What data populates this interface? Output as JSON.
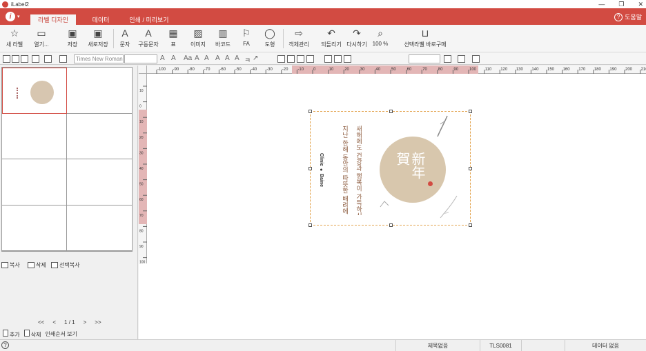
{
  "window": {
    "title": "iLabel2",
    "controls": [
      "—",
      "❐",
      "✕"
    ]
  },
  "ribbon": {
    "file_arrow": "▾",
    "tabs": [
      {
        "label": "라벨 디자인",
        "active": true
      },
      {
        "label": "데이터",
        "active": false
      },
      {
        "label": "인쇄 / 미리보기",
        "active": false
      }
    ],
    "help_label": "도움말"
  },
  "toolbar": {
    "buttons": [
      {
        "label": "새 라벨",
        "icon": "new-label-icon"
      },
      {
        "label": "열기...",
        "icon": "open-folder-icon"
      },
      {
        "label": "저장",
        "icon": "save-icon"
      },
      {
        "label": "새로저장",
        "icon": "save-as-icon"
      },
      {
        "label": "문자",
        "icon": "text-icon"
      },
      {
        "label": "구동문자",
        "icon": "variable-text-icon"
      },
      {
        "label": "표",
        "icon": "table-icon"
      },
      {
        "label": "이미지",
        "icon": "image-icon"
      },
      {
        "label": "바코드",
        "icon": "barcode-icon"
      },
      {
        "label": "FA",
        "icon": "fa-icon"
      },
      {
        "label": "도형",
        "icon": "shape-icon"
      },
      {
        "label": "객체관리",
        "icon": "object-manage-icon"
      },
      {
        "label": "되돌리기",
        "icon": "undo-icon"
      },
      {
        "label": "다시하기",
        "icon": "redo-icon"
      },
      {
        "label": "100 %",
        "icon": "zoom-icon"
      },
      {
        "label": "선택라벨 바로구매",
        "icon": "basket-icon"
      }
    ]
  },
  "format": {
    "font_name": "Times New Roman"
  },
  "ruler": {
    "h_ticks": [
      "-100",
      "-90",
      "-80",
      "-70",
      "-60",
      "-50",
      "-40",
      "-30",
      "-20",
      "-10",
      "0",
      "10",
      "20",
      "30",
      "40",
      "50",
      "60",
      "70",
      "80",
      "90",
      "100",
      "110",
      "120",
      "130",
      "140",
      "150",
      "160",
      "170",
      "180",
      "190",
      "200",
      "210"
    ],
    "v_ticks": [
      "10",
      "0",
      "10",
      "20",
      "30",
      "40",
      "50",
      "60",
      "70",
      "80",
      "90",
      "100"
    ]
  },
  "label": {
    "circle_text": "新年賀",
    "vertical_text_1": "지난 한해 동안의 따뜻한 배려에 감사드립니다",
    "vertical_text_2": "새해에도 건강과 행복이 가득하시길 바랍니다",
    "brand": "Clinic ● Baine"
  },
  "left_panel": {
    "copy_label": "복사",
    "delete_label": "삭제",
    "select_copy_label": "선택복사",
    "pager": {
      "first": "<<",
      "prev": "<",
      "page": "1 / 1",
      "next": ">",
      "last": ">>"
    },
    "add_label": "추가",
    "delete2_label": "삭제",
    "print_order_label": "인쇄순서 보기"
  },
  "status": {
    "help": "?",
    "title_status": "제목없음",
    "code": "TLS0081",
    "data_status": "데이터 없음"
  }
}
